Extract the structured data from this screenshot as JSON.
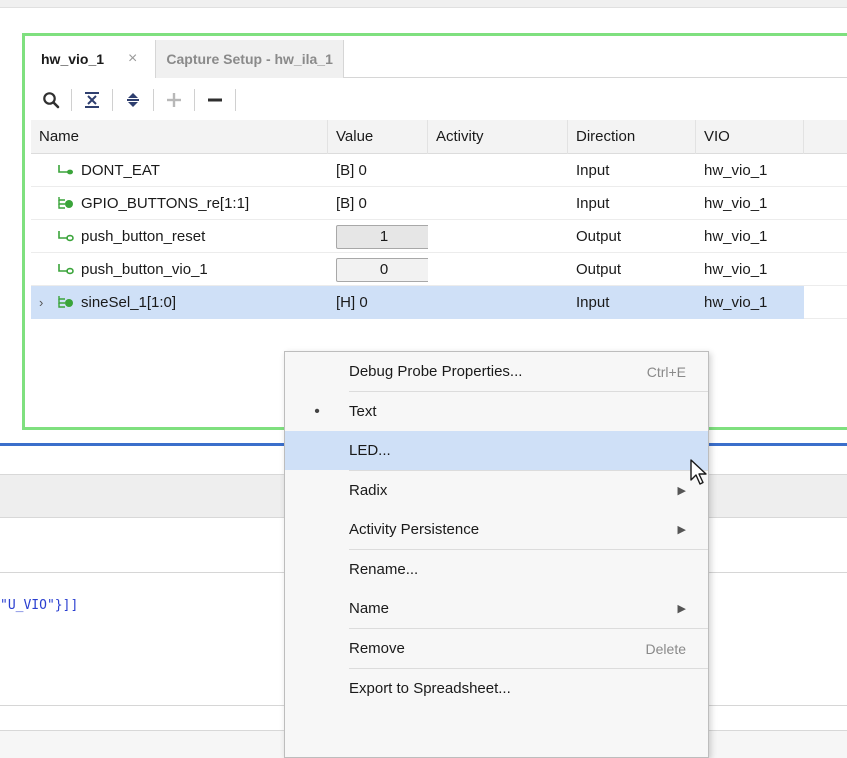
{
  "tabs": [
    {
      "label": "hw_vio_1",
      "close": "×"
    },
    {
      "label": "Capture Setup - hw_ila_1"
    }
  ],
  "toolbar": {
    "icons": [
      "search-icon",
      "collapse-all-icon",
      "expand-all-icon",
      "add-icon",
      "remove-icon"
    ]
  },
  "table": {
    "headers": [
      "Name",
      "Value",
      "Activity",
      "Direction",
      "VIO"
    ],
    "rows": [
      {
        "name": "DONT_EAT",
        "value": "[B] 0",
        "activity": "",
        "direction": "Input",
        "vio": "hw_vio_1"
      },
      {
        "name": "GPIO_BUTTONS_re[1:1]",
        "value": "[B] 0",
        "activity": "",
        "direction": "Input",
        "vio": "hw_vio_1"
      },
      {
        "name": "push_button_reset",
        "value": "1",
        "activity": "",
        "direction": "Output",
        "vio": "hw_vio_1"
      },
      {
        "name": "push_button_vio_1",
        "value": "0",
        "activity": "",
        "direction": "Output",
        "vio": "hw_vio_1"
      },
      {
        "name": "sineSel_1[1:0]",
        "value": "[H] 0",
        "activity": "",
        "direction": "Input",
        "vio": "hw_vio_1",
        "expand": "›"
      }
    ]
  },
  "code_fragment": "\"U_VIO\"}]]",
  "context_menu": {
    "items": [
      {
        "label": "Debug Probe Properties...",
        "shortcut": "Ctrl+E"
      },
      {
        "label": "Text",
        "bullet": "•"
      },
      {
        "label": "LED..."
      },
      {
        "label": "Radix"
      },
      {
        "label": "Activity Persistence"
      },
      {
        "label": "Rename..."
      },
      {
        "label": "Name"
      },
      {
        "label": "Remove",
        "shortcut": "Delete"
      },
      {
        "label": "Export to Spreadsheet..."
      }
    ]
  },
  "colors": {
    "frame_border": "#7fe07f",
    "selection": "#cfe0f7",
    "divider_blue": "#3b6fcb",
    "probe_icon_green": "#3aa43a"
  }
}
